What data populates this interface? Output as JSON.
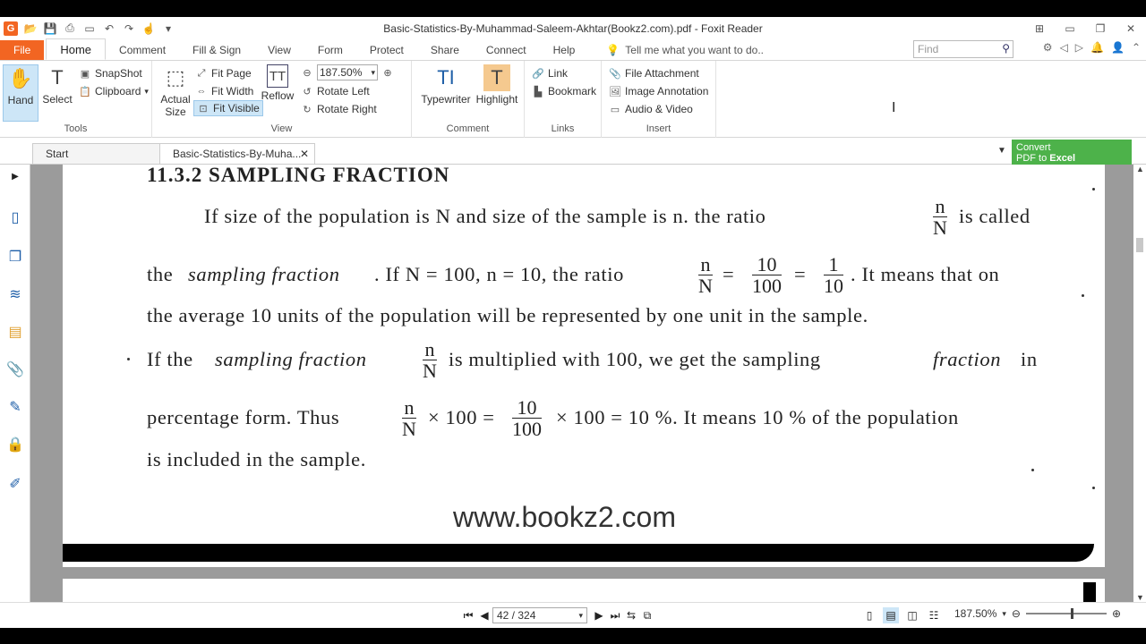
{
  "window": {
    "title": "Basic-Statistics-By-Muhammad-Saleem-Akhtar(Bookz2.com).pdf - Foxit Reader"
  },
  "menu": {
    "tabs": [
      "File",
      "Home",
      "Comment",
      "Fill & Sign",
      "View",
      "Form",
      "Protect",
      "Share",
      "Connect",
      "Help"
    ],
    "tell_me": "Tell me what you want to do..",
    "find_placeholder": "Find"
  },
  "ribbon": {
    "tools": {
      "hand": "Hand",
      "select": "Select",
      "snapshot": "SnapShot",
      "clipboard": "Clipboard",
      "label": "Tools"
    },
    "view": {
      "actual_size": "Actual Size",
      "fit_page": "Fit Page",
      "fit_width": "Fit Width",
      "fit_visible": "Fit Visible",
      "reflow": "Reflow",
      "zoom": "187.50%",
      "rotate_left": "Rotate Left",
      "rotate_right": "Rotate Right",
      "label": "View"
    },
    "comment": {
      "typewriter": "Typewriter",
      "highlight": "Highlight",
      "label": "Comment"
    },
    "links": {
      "link": "Link",
      "bookmark": "Bookmark",
      "label": "Links"
    },
    "insert": {
      "file_attachment": "File Attachment",
      "image_annotation": "Image Annotation",
      "audio_video": "Audio & Video",
      "label": "Insert"
    }
  },
  "doc_tabs": {
    "start": "Start",
    "current": "Basic-Statistics-By-Muha..."
  },
  "convert_banner": {
    "line1": "Convert",
    "line2a": "PDF to ",
    "line2b": "Excel"
  },
  "page": {
    "heading": "11.3.2 SAMPLING  FRACTION",
    "l1a": "If size of the population is N and size of the sample is n. the ratio",
    "l1b": "is called",
    "l2a": "the",
    "l2b": "sampling fraction",
    "l2c": ". If N = 100, n = 10, the ratio",
    "l2d": ". It means that on",
    "l3": "the average 10 units of the population will be represented by one unit in the sample.",
    "l4a": "If the",
    "l4b": "sampling fraction",
    "l4c": "is multiplied with 100, we get the sampling",
    "l4d": "fraction",
    "l4e": "in",
    "l5a": "percentage form. Thus",
    "l5b": "× 100 =",
    "l5c": "× 100 = 10 %. It means 10 % of the population",
    "l6": "is included in the sample.",
    "frac_n": "n",
    "frac_N": "N",
    "frac_10": "10",
    "frac_100": "100",
    "frac_1": "1",
    "eq": "=",
    "watermark": "www.bookz2.com"
  },
  "status": {
    "page_indicator": "42 / 324",
    "zoom": "187.50%"
  }
}
